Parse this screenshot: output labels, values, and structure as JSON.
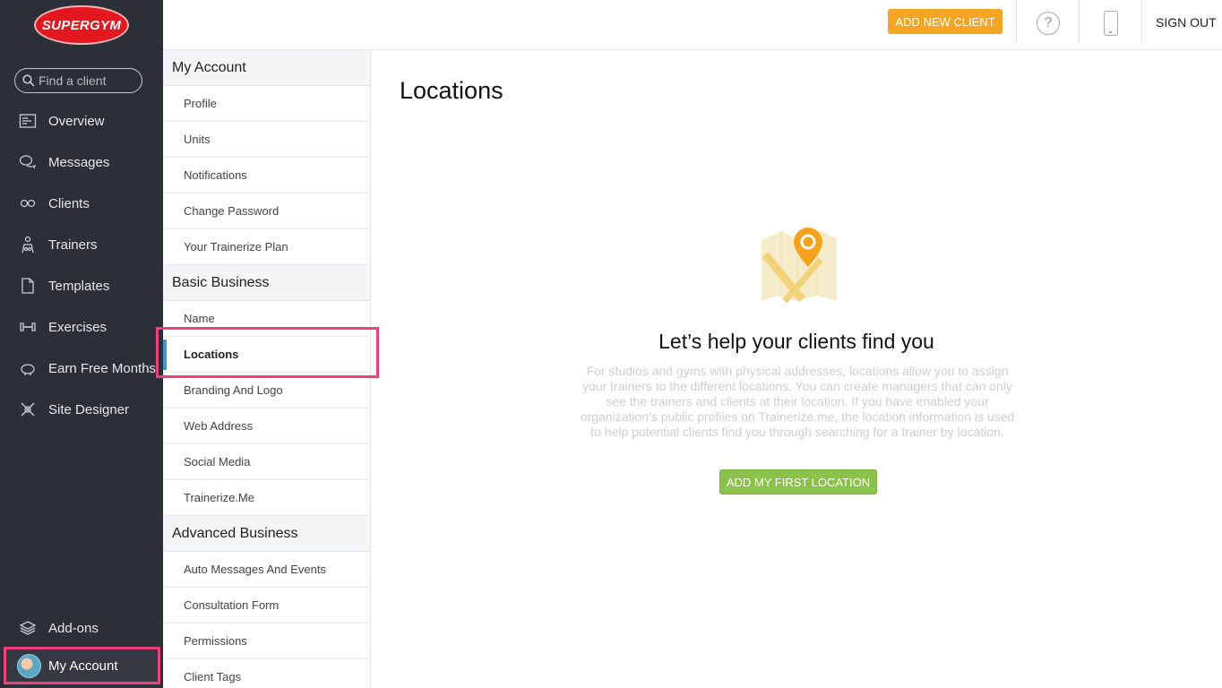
{
  "brand": {
    "logo_text": "SUPERGYM",
    "accent": "#e3171e"
  },
  "search": {
    "placeholder": "Find a client"
  },
  "sidebar": {
    "items": [
      {
        "label": "Overview",
        "icon": "overview-icon"
      },
      {
        "label": "Messages",
        "icon": "messages-icon"
      },
      {
        "label": "Clients",
        "icon": "clients-icon"
      },
      {
        "label": "Trainers",
        "icon": "trainers-icon"
      },
      {
        "label": "Templates",
        "icon": "templates-icon"
      },
      {
        "label": "Exercises",
        "icon": "dumbbell-icon"
      },
      {
        "label": "Earn Free Months",
        "icon": "piggy-bank-icon"
      },
      {
        "label": "Site Designer",
        "icon": "site-designer-icon"
      }
    ],
    "addons": {
      "label": "Add-ons",
      "icon": "layers-icon"
    },
    "account": {
      "label": "My Account"
    }
  },
  "topbar": {
    "add_client": "ADD NEW CLIENT",
    "help_glyph": "?",
    "sign_out": "SIGN OUT",
    "add_client_color": "#f6a623"
  },
  "submenu": {
    "groups": [
      {
        "title": "My Account",
        "items": [
          "Profile",
          "Units",
          "Notifications",
          "Change Password",
          "Your Trainerize Plan"
        ]
      },
      {
        "title": "Basic Business",
        "items": [
          "Name",
          "Locations",
          "Branding And Logo",
          "Web Address",
          "Social Media",
          "Trainerize.Me"
        ]
      },
      {
        "title": "Advanced Business",
        "items": [
          "Auto Messages And Events",
          "Consultation Form",
          "Permissions",
          "Client Tags"
        ]
      }
    ],
    "active": "Locations"
  },
  "main": {
    "title": "Locations",
    "empty_title": "Let’s help your clients find you",
    "empty_desc": "For studios and gyms with physical addresses, locations allow you to assign your trainers to the different locations. You can create managers that can only see the trainers and clients at their location. If you have enabled your organization’s public profiles on Trainerize.me, the location information is used to help potential clients find you through searching for a trainer by location.",
    "add_location": "ADD MY FIRST LOCATION",
    "add_location_color": "#8bc34a"
  }
}
